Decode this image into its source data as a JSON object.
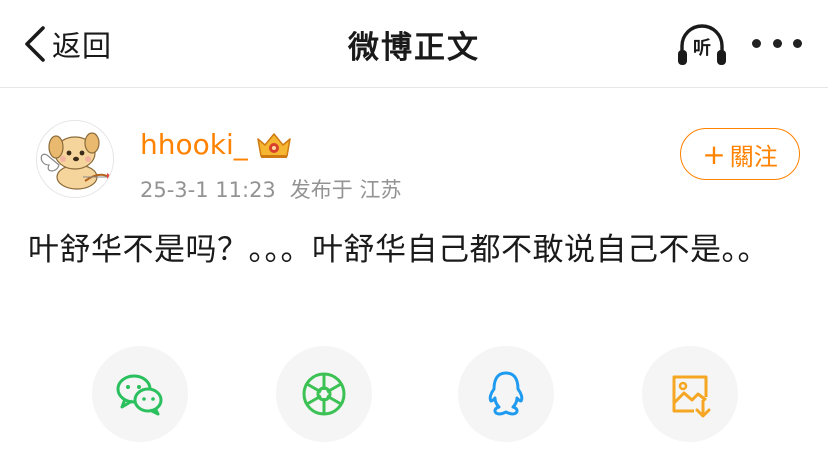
{
  "nav": {
    "back_label": "返回",
    "title": "微博正文",
    "listen_label": "听"
  },
  "post": {
    "username": "hhooki_",
    "date": "25-3-1 11:23",
    "location": "发布于 江苏",
    "follow_label": "關注",
    "content": "叶舒华不是吗？。。。叶舒华自己都不敢说自己不是。。"
  },
  "share": {
    "icons": [
      "wechat-icon",
      "moments-icon",
      "qq-icon",
      "save-image-icon"
    ]
  },
  "colors": {
    "accent": "#ff8200",
    "wechat": "#2ac05e",
    "moments": "#3cc254",
    "qq": "#1e9bf0",
    "save": "#f5a623",
    "meta": "#939393"
  }
}
